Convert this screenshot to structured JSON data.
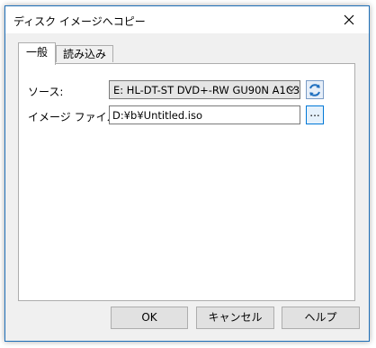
{
  "window": {
    "title": "ディスク イメージへコピー",
    "close_icon": "close-icon"
  },
  "tabs": [
    {
      "label": "一般",
      "active": true
    },
    {
      "label": "読み込み",
      "active": false
    }
  ],
  "form": {
    "source_label": "ソース:",
    "source_value": "E: HL-DT-ST DVD+-RW GU90N A1C3",
    "refresh_icon": "refresh-icon",
    "image_file_label": "イメージ ファイル:",
    "image_file_value": "D:¥b¥Untitled.iso",
    "browse_label": "..."
  },
  "buttons": {
    "ok": "OK",
    "cancel": "キャンセル",
    "help": "ヘルプ"
  },
  "colors": {
    "window_border": "#1e6fb8",
    "dialog_bg": "#f0f0f0",
    "refresh_icon": "#1f6fbf"
  }
}
